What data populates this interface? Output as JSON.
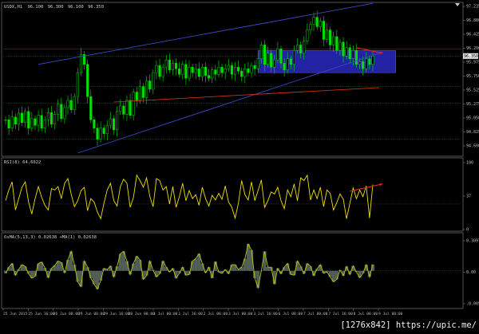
{
  "terminal": {
    "symbol": "USDX,H1",
    "ohlc": {
      "open": "96.100",
      "high": "96.300",
      "low": "96.100",
      "close": "96.350"
    },
    "current_price_badge": "96.350",
    "rsi_label": "RSI(8) 64.6022",
    "osma_label": "OsMA(5,13,3) 0.02638  +MA(1) 0.02638",
    "watermark": "[1276x842] https://upic.me/"
  },
  "colors": {
    "background": "#000000",
    "bull_candle": "#00e000",
    "bear_candle": "#00e000",
    "rsi_line": "#f0e000",
    "osma_line": "#b4c814",
    "channel_line": "#3c46c8",
    "support_line": "#c83214",
    "sell_zone": "#2828c0",
    "annotation_arrow": "#e62020"
  },
  "chart_data": [
    {
      "type": "candlestick",
      "title": "USDX,H1",
      "x_tick_labels": [
        "25 Jun 2015",
        "25 Jun 16:00",
        "26 Jun 08:00",
        "29 Jun 00:00",
        "29 Jun 16:00",
        "30 Jun 08:00",
        "1 Jul 00:00",
        "1 Jul 16:00",
        "2 Jul 08:00",
        "3 Jul 00:00",
        "3 Jul 16:00",
        "6 Jul 08:00",
        "7 Jul 00:00",
        "7 Jul 16:00",
        "8 Jul 08:00",
        "9 Jul 00:00"
      ],
      "y_tick_labels": [
        "97.235",
        "96.880",
        "96.425",
        "96.200",
        "95.975",
        "95.750",
        "95.525",
        "95.275",
        "95.050",
        "94.825",
        "94.600"
      ],
      "ylim": [
        94.6,
        97.26
      ],
      "current_price": 96.35,
      "close": [
        95.2,
        95.05,
        95.25,
        95.12,
        95.32,
        95.15,
        95.35,
        95.05,
        95.22,
        95.1,
        95.28,
        95.05,
        95.2,
        95.33,
        95.12,
        95.3,
        95.48,
        95.22,
        95.42,
        95.55,
        95.38,
        95.62,
        96.05,
        96.38,
        96.2,
        95.62,
        95.2,
        95.05,
        94.85,
        95.05,
        94.95,
        95.1,
        95.22,
        95.02,
        95.35,
        95.45,
        95.3,
        95.55,
        95.28,
        95.7,
        95.55,
        95.8,
        95.6,
        95.9,
        95.75,
        96.05,
        96.18,
        95.98,
        96.15,
        96.28,
        96.1,
        96.22,
        96.12,
        96.02,
        96.2,
        95.95,
        96.15,
        96.05,
        96.12,
        95.98,
        96.15,
        96.0,
        95.95,
        96.1,
        96.02,
        96.15,
        96.05,
        96.12,
        96.18,
        96.02,
        96.15,
        96.08,
        95.98,
        96.12,
        96.05,
        96.18,
        96.12,
        96.3,
        96.55,
        96.2,
        96.4,
        96.15,
        96.28,
        96.48,
        96.22,
        96.1,
        96.3,
        96.2,
        96.45,
        96.55,
        96.4,
        96.62,
        96.82,
        96.92,
        97.05,
        96.88,
        96.98,
        96.65,
        96.82,
        96.55,
        96.7,
        96.45,
        96.6,
        96.35,
        96.5,
        96.3,
        96.45,
        96.2,
        96.25,
        96.12,
        96.3,
        96.2,
        96.35
      ],
      "drawings": [
        {
          "type": "trendline",
          "name": "upper channel",
          "from": [
            10,
            96.2
          ],
          "to": [
            112,
            97.3
          ]
        },
        {
          "type": "trendline",
          "name": "lower channel",
          "from": [
            22,
            94.6
          ],
          "to": [
            115,
            96.42
          ]
        },
        {
          "type": "trendline",
          "name": "support",
          "from": [
            33,
            95.52
          ],
          "to": [
            114,
            95.78
          ]
        },
        {
          "type": "rectangle",
          "name": "resistance zone",
          "from": [
            77,
            96.45
          ],
          "to": [
            119,
            96.05
          ]
        },
        {
          "type": "arrow",
          "name": "price up arrow",
          "from": [
            107,
            96.5
          ],
          "to": [
            115,
            96.4
          ]
        },
        {
          "type": "horizontal_levels",
          "name": "fibonacci levels",
          "levels": [
            96.48,
            96.35,
            95.8,
            95.5,
            94.85
          ]
        }
      ]
    },
    {
      "type": "line",
      "title": "RSI(8) 64.6022",
      "y_tick_labels": [
        "100",
        "37",
        "0"
      ],
      "ylim": [
        0,
        100
      ],
      "values": [
        42,
        58,
        70,
        28,
        45,
        62,
        70,
        40,
        22,
        45,
        63,
        47,
        35,
        28,
        60,
        58,
        63,
        45,
        68,
        75,
        52,
        33,
        42,
        57,
        62,
        27,
        45,
        40,
        25,
        15,
        38,
        58,
        68,
        42,
        34,
        63,
        74,
        68,
        32,
        47,
        80,
        72,
        62,
        76,
        48,
        33,
        75,
        72,
        58,
        63,
        37,
        63,
        32,
        48,
        68,
        42,
        57,
        45,
        51,
        35,
        62,
        45,
        34,
        50,
        43,
        53,
        44,
        64,
        40,
        32,
        16,
        38,
        72,
        51,
        43,
        70,
        42,
        57,
        73,
        32,
        42,
        55,
        52,
        62,
        42,
        30,
        58,
        48,
        67,
        42,
        76,
        72,
        80,
        43,
        58,
        45,
        62,
        33,
        58,
        53,
        28,
        39,
        52,
        44,
        15,
        38,
        61,
        45,
        58,
        48,
        64,
        16,
        66
      ],
      "drawings": [
        {
          "type": "arrow",
          "name": "rsi divergence arrow",
          "from": [
            105,
            56
          ],
          "to": [
            115,
            67
          ]
        }
      ]
    },
    {
      "type": "area",
      "title": "OsMA(5,13,3) 0.02638  +MA(1) 0.02638",
      "y_tick_labels": [
        "0.3097",
        "0.00",
        "-0.0059"
      ],
      "ylim": [
        -0.145,
        0.14
      ],
      "values": [
        -0.01,
        0.015,
        0.03,
        -0.018,
        0.006,
        0.025,
        0.018,
        -0.012,
        -0.03,
        -0.022,
        0.03,
        0.036,
        0.012,
        -0.028,
        0.01,
        0.022,
        0.04,
        0.034,
        -0.008,
        0.045,
        0.08,
        0.025,
        -0.045,
        -0.065,
        0.04,
        0.015,
        -0.03,
        -0.055,
        -0.075,
        -0.04,
        0.01,
        0.005,
        0.02,
        -0.025,
        0.018,
        0.07,
        0.08,
        0.04,
        -0.015,
        0.03,
        0.06,
        0.045,
        -0.035,
        -0.02,
        0.04,
        0.002,
        -0.025,
        -0.012,
        0.04,
        0.015,
        -0.005,
        0.01,
        -0.03,
        -0.01,
        0.015,
        -0.018,
        -0.015,
        0.04,
        0.05,
        0.07,
        0.03,
        -0.008,
        0.015,
        -0.03,
        0.038,
        -0.005,
        -0.01,
        0.005,
        -0.012,
        0.025,
        0.025,
        0.005,
        0.015,
        0.05,
        0.11,
        0.085,
        -0.03,
        -0.07,
        0.0,
        0.08,
        0.015,
        0.015,
        -0.055,
        0.01,
        -0.012,
        0.015,
        0.03,
        -0.015,
        -0.018,
        0.04,
        0.018,
        -0.012,
        0.03,
        0.018,
        -0.02,
        0.008,
        0.025,
        -0.01,
        -0.004,
        -0.025,
        -0.045,
        -0.035,
        0.003,
        -0.02,
        0.018,
        -0.015,
        0.02,
        -0.005,
        -0.028,
        -0.01,
        0.025,
        -0.025,
        0.026
      ]
    }
  ]
}
